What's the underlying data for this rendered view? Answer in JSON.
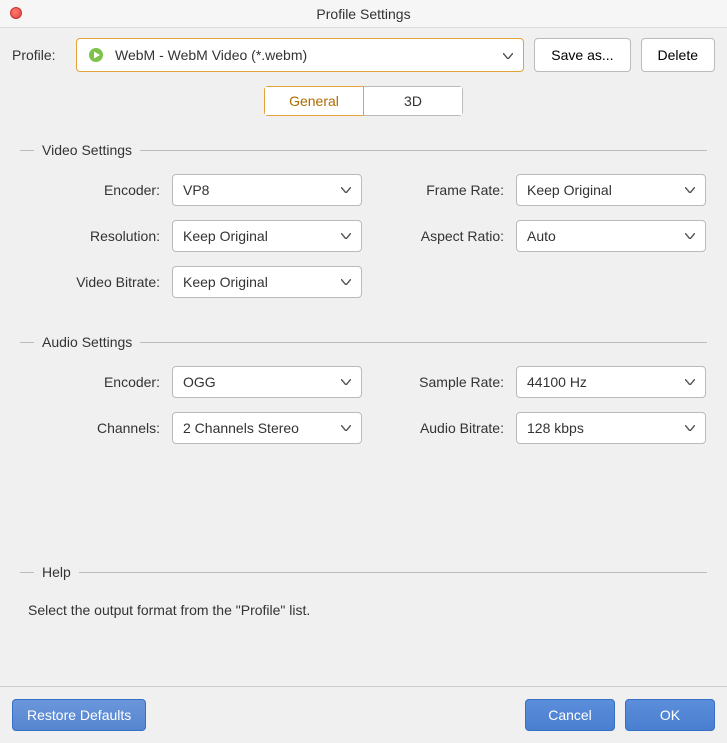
{
  "title": "Profile Settings",
  "toolbar": {
    "profile_label": "Profile:",
    "profile_value": "WebM - WebM Video (*.webm)",
    "save_as_label": "Save as...",
    "delete_label": "Delete"
  },
  "tabs": {
    "general": "General",
    "threeD": "3D"
  },
  "video": {
    "title": "Video Settings",
    "encoder_label": "Encoder:",
    "encoder_value": "VP8",
    "framerate_label": "Frame Rate:",
    "framerate_value": "Keep Original",
    "resolution_label": "Resolution:",
    "resolution_value": "Keep Original",
    "aspect_label": "Aspect Ratio:",
    "aspect_value": "Auto",
    "bitrate_label": "Video Bitrate:",
    "bitrate_value": "Keep Original"
  },
  "audio": {
    "title": "Audio Settings",
    "encoder_label": "Encoder:",
    "encoder_value": "OGG",
    "samplerate_label": "Sample Rate:",
    "samplerate_value": "44100 Hz",
    "channels_label": "Channels:",
    "channels_value": "2 Channels Stereo",
    "bitrate_label": "Audio Bitrate:",
    "bitrate_value": "128 kbps"
  },
  "help": {
    "title": "Help",
    "text": "Select the output format from the \"Profile\" list."
  },
  "footer": {
    "restore": "Restore Defaults",
    "cancel": "Cancel",
    "ok": "OK"
  }
}
